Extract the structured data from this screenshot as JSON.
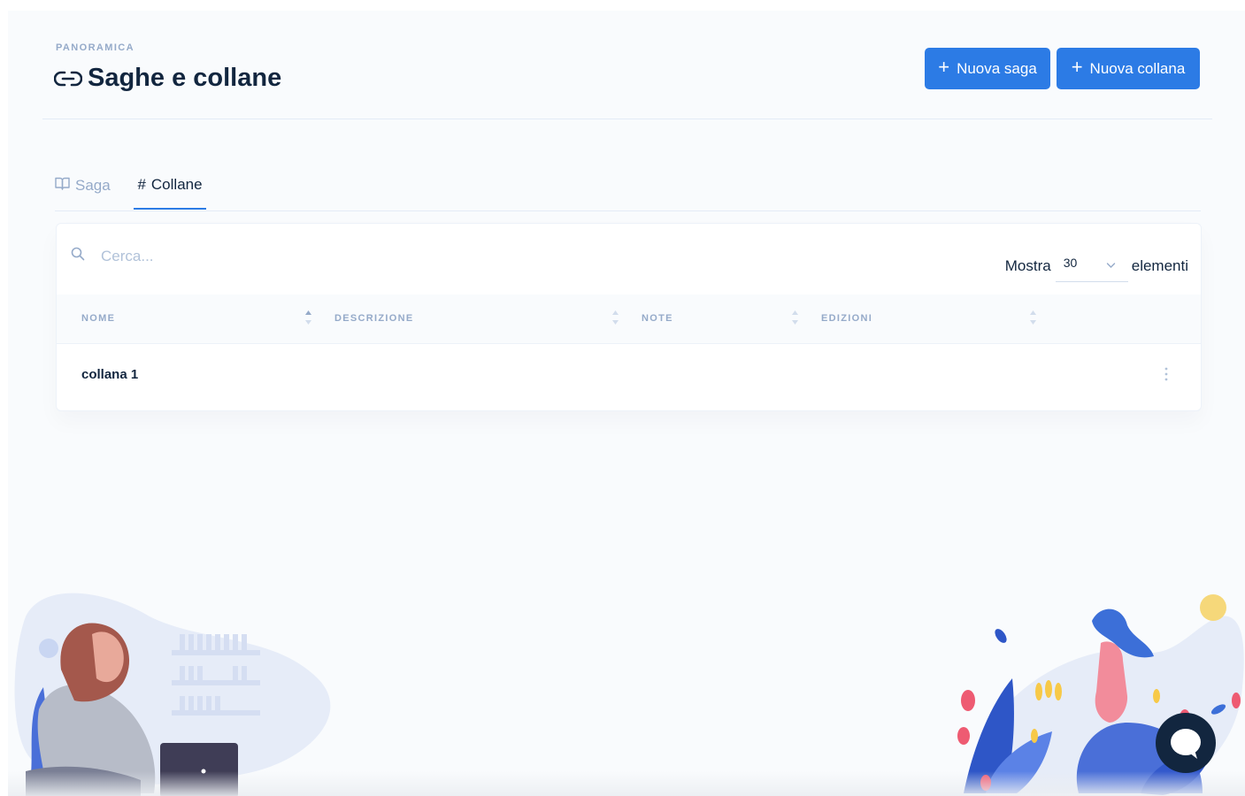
{
  "header": {
    "pretitle": "PANORAMICA",
    "title": "Saghe e collane",
    "title_icon": "link-icon",
    "buttons": {
      "new_saga": "Nuova saga",
      "new_collana": "Nuova collana",
      "plus_symbol": "+"
    }
  },
  "tabs": [
    {
      "label": "Saga",
      "icon": "book-icon",
      "active": false
    },
    {
      "label": "Collane",
      "icon_text": "#",
      "active": true
    }
  ],
  "search": {
    "placeholder": "Cerca..."
  },
  "page_size": {
    "label_before": "Mostra",
    "value": "30",
    "label_after": "elementi"
  },
  "table": {
    "columns": [
      "NOME",
      "DESCRIZIONE",
      "NOTE",
      "EDIZIONI"
    ],
    "sorted_column": "NOME",
    "rows": [
      {
        "nome": "collana 1",
        "descrizione": "",
        "note": "",
        "edizioni": ""
      }
    ]
  },
  "colors": {
    "primary": "#2c7be5",
    "text": "#12263f",
    "muted": "#95aac9",
    "background": "#f9fbfd"
  }
}
